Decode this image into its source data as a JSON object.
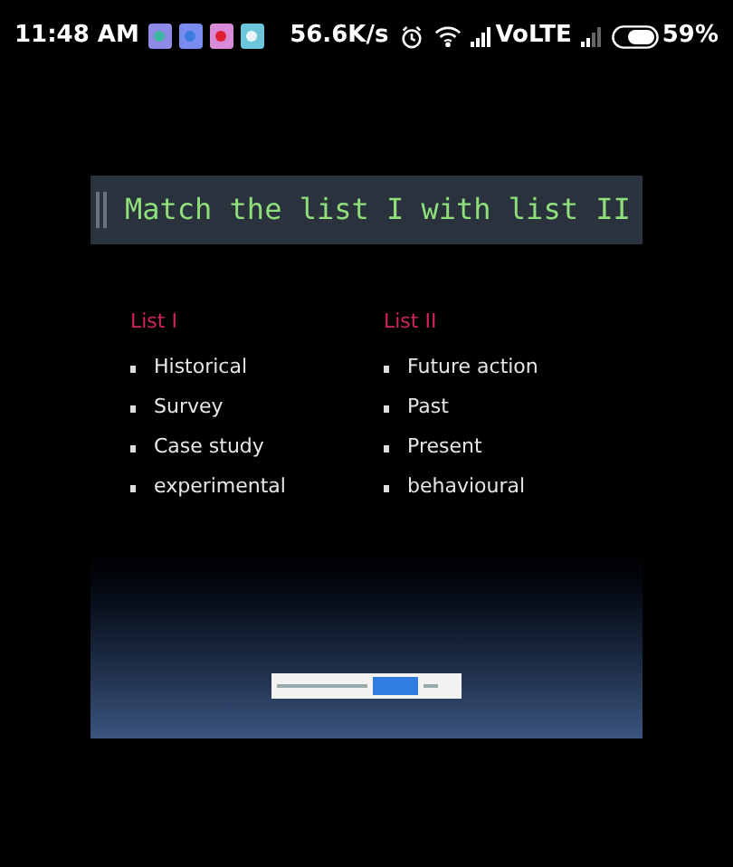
{
  "status_bar": {
    "time": "11:48 AM",
    "speed": "56.6K/s",
    "network": "VoLTE",
    "battery": "59%"
  },
  "slide": {
    "title": "Match the list I with list II",
    "columns": [
      {
        "heading": "List I",
        "items": [
          "Historical",
          "Survey",
          "Case study",
          "experimental"
        ]
      },
      {
        "heading": "List II",
        "items": [
          "Future action",
          "Past",
          "Present",
          "behavioural"
        ]
      }
    ]
  }
}
